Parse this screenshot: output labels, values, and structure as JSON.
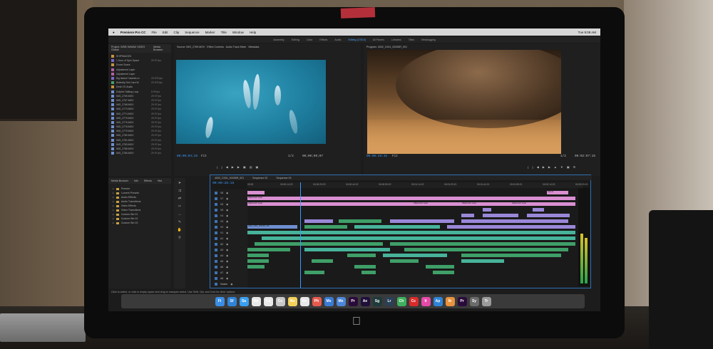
{
  "menubar": {
    "app_name": "Premiere Pro CC",
    "items": [
      "File",
      "Edit",
      "Clip",
      "Sequence",
      "Marker",
      "Title",
      "Window",
      "Help"
    ],
    "clock": "Tue 9:08 AM"
  },
  "workspaces": [
    "Assembly",
    "Editing",
    "Color",
    "Effects",
    "Audio",
    "Editing (CS5.5)",
    "All Panels",
    "Libraries",
    "Titles",
    "Metalogging"
  ],
  "project": {
    "tabs": [
      "Project: WDB HAWAII VIDEO Global",
      "Media Browser"
    ],
    "rows": [
      {
        "name": "SHIPIMAGES",
        "fps": "",
        "color": "#c5923d"
      },
      {
        "name": "1 Hour of Spin Space",
        "fps": "29.97 fps",
        "color": "#7b67c7"
      },
      {
        "name": "Drone Scans",
        "fps": "",
        "color": "#c5923d"
      },
      {
        "name": "Adjustment Layer",
        "fps": "",
        "color": "#b45fa8"
      },
      {
        "name": "Adjustment Layer",
        "fps": "",
        "color": "#b45fa8"
      },
      {
        "name": "Big Island Tutorials.m",
        "fps": "23.976 fps",
        "color": "#7b67c7"
      },
      {
        "name": "Butterfly Sml Card W",
        "fps": "23.976 fps",
        "color": "#3f9f68"
      },
      {
        "name": "Desk VO Audio",
        "fps": "",
        "color": "#c5923d"
      },
      {
        "name": "Dolphin Talking Loop",
        "fps": "5.99 fps",
        "color": "#6e8fd0"
      },
      {
        "name": "IMG_2769.MOV",
        "fps": "29.97 fps",
        "color": "#6e8fd0"
      },
      {
        "name": "IMG_2767.MOV",
        "fps": "29.97 fps",
        "color": "#6e8fd0"
      },
      {
        "name": "IMG_2768.MOV",
        "fps": "29.97 fps",
        "color": "#6e8fd0"
      },
      {
        "name": "IMG_2773.MOV",
        "fps": "29.97 fps",
        "color": "#6e8fd0"
      },
      {
        "name": "IMG_2774.MOV",
        "fps": "29.97 fps",
        "color": "#6e8fd0"
      },
      {
        "name": "IMG_2775.MOV",
        "fps": "29.97 fps",
        "color": "#6e8fd0"
      },
      {
        "name": "IMG_2776.MOV",
        "fps": "29.97 fps",
        "color": "#6e8fd0"
      },
      {
        "name": "IMG_2778.MOV",
        "fps": "29.97 fps",
        "color": "#6e8fd0"
      },
      {
        "name": "IMG_2779.MOV",
        "fps": "29.97 fps",
        "color": "#6e8fd0"
      },
      {
        "name": "IMG_2780.MOV",
        "fps": "29.97 fps",
        "color": "#6e8fd0"
      },
      {
        "name": "IMG_2781.MOV",
        "fps": "29.97 fps",
        "color": "#6e8fd0"
      },
      {
        "name": "IMG_2783.MOV",
        "fps": "29.97 fps",
        "color": "#6e8fd0"
      },
      {
        "name": "IMG_2785.MOV",
        "fps": "29.97 fps",
        "color": "#6e8fd0"
      },
      {
        "name": "IMG_2786.MOV",
        "fps": "29.97 fps",
        "color": "#6e8fd0"
      }
    ]
  },
  "source_monitor": {
    "title": "Source: IMG_2769.MOV",
    "tabs_extra": [
      "Effect Controls",
      "Audio Track Mixer",
      "Metadata"
    ],
    "timecode": "00;00;04;19",
    "fit": "Fit",
    "scale": "1/2",
    "duration": "00;00;00;07"
  },
  "program_monitor": {
    "title": "Program: 4002_C001_00335R_001",
    "timecode": "00:00:28:15",
    "fit": "Fit",
    "scale": "1/2",
    "duration": "00:02:07:15"
  },
  "effects": {
    "tabs": [
      "Media Browser",
      "Info",
      "Effects",
      "Hist"
    ],
    "items": [
      "Presets",
      "Lumetri Presets",
      "Audio Effects",
      "Audio Transitions",
      "Video Effects",
      "Video Transitions",
      "Custom Bin 01",
      "Custom Bin 02",
      "Custom Bin 03"
    ]
  },
  "timeline": {
    "tabs": [
      "4002_C001_00335R_001",
      "Sequence 02",
      "Sequence 03"
    ],
    "timecode": "00:00:28:15",
    "ruler": [
      "00:00",
      "00:00:14:23",
      "00:00:29:23",
      "00:00:44:22",
      "00:00:59:22",
      "00:01:14:22",
      "00:01:29:21",
      "00:01:44:21",
      "00:01:59:21",
      "00:02:14:20",
      "00:02:29:20"
    ],
    "tracks": [
      "V8",
      "V7",
      "V6",
      "V5",
      "V4",
      "V3",
      "V2",
      "V1",
      "A1",
      "A2",
      "A3",
      "A4",
      "A5",
      "A6",
      "A7",
      "A8",
      "Master"
    ],
    "clip_labels": [
      "Adjustment Layer",
      "Adjustment Layer",
      "Adjustment Layer",
      "Adjustment Layer",
      "Adjustment Layer",
      "4002_C001_00335R_001",
      "Title 01"
    ]
  },
  "status": "Click to select, or click in empty space and drag to marquee select. Use Shift, Opt, and Cmd for other options.",
  "dock": [
    "Fi",
    "Sf",
    "Sa",
    "Ma",
    "Ca",
    "Co",
    "No",
    "Re",
    "Ph",
    "Ms",
    "Ms",
    "Pr",
    "Ae",
    "Sg",
    "Lr",
    "Ch",
    "Cc",
    "It",
    "Ap",
    "Ib",
    "Pr",
    "Sy",
    "Tr"
  ]
}
